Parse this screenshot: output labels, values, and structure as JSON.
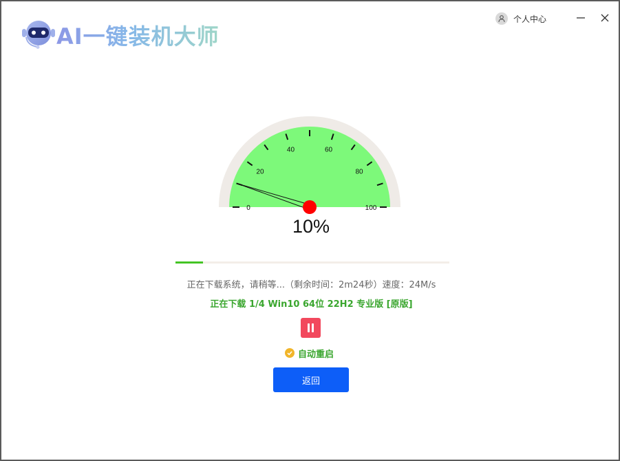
{
  "app": {
    "title": "AI一键装机大师",
    "user_center_label": "个人中心"
  },
  "gauge": {
    "value_percent": 10,
    "percent_text": "10%",
    "ticks": [
      "0",
      "20",
      "40",
      "60",
      "80",
      "100"
    ],
    "colors": {
      "fill": "#7df97a",
      "ring": "#efebe7",
      "needle_cap": "#ff0000"
    }
  },
  "progress": {
    "fraction": 0.1,
    "color": "#44c424"
  },
  "status": {
    "line": "正在下载系统，请稍等...（剩余时间：2m24秒）速度：24M/s",
    "download": "正在下载 1/4 Win10 64位 22H2 专业版 [原版]"
  },
  "controls": {
    "auto_restart_label": "自动重启",
    "back_label": "返回"
  },
  "icons": [
    "robot-logo-icon",
    "user-icon",
    "minimize-icon",
    "close-icon",
    "pause-icon",
    "check-icon"
  ]
}
